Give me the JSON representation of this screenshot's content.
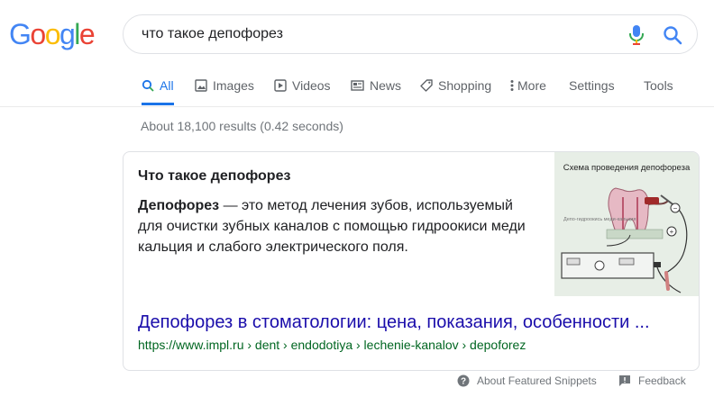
{
  "logo": {
    "text": "Google",
    "letters": [
      "G",
      "o",
      "o",
      "g",
      "l",
      "e"
    ],
    "colors": [
      "#4285F4",
      "#EA4335",
      "#FBBC05",
      "#4285F4",
      "#34A853",
      "#EA4335"
    ]
  },
  "search": {
    "query": "что такое депофорез",
    "mic_icon": "microphone-icon",
    "search_icon": "magnifier-icon"
  },
  "tabs": [
    {
      "label": "All",
      "icon": "search-icon",
      "active": true
    },
    {
      "label": "Images",
      "icon": "image-icon"
    },
    {
      "label": "Videos",
      "icon": "play-icon"
    },
    {
      "label": "News",
      "icon": "newspaper-icon"
    },
    {
      "label": "Shopping",
      "icon": "tag-icon"
    },
    {
      "label": "More",
      "icon": "dots-vertical-icon"
    },
    {
      "label": "Settings"
    },
    {
      "label": "Tools"
    }
  ],
  "result_stats": "About 18,100 results (0.42 seconds)",
  "featured_snippet": {
    "title": "Что такое депофорез",
    "body_bold": "Депофорез",
    "body_rest": " — это метод лечения зубов, используемый для очистки зубных каналов с помощью гидроокиси меди кальция и слабого электрического поля.",
    "image": {
      "caption": "Схема проведения депофореза",
      "label": "Депо-гидроокись меди-кальция",
      "minus": "−",
      "plus": "+"
    },
    "link_title": "Депофорез в стоматологии: цена, показания, особенности ...",
    "url": "https://www.impl.ru › dent › endodotiya › lechenie-kanalov › depoforez"
  },
  "footer": {
    "about": "About Featured Snippets",
    "feedback": "Feedback"
  },
  "colors": {
    "link": "#1a0dab",
    "url": "#006621",
    "accent": "#1a73e8",
    "muted": "#70757a"
  }
}
